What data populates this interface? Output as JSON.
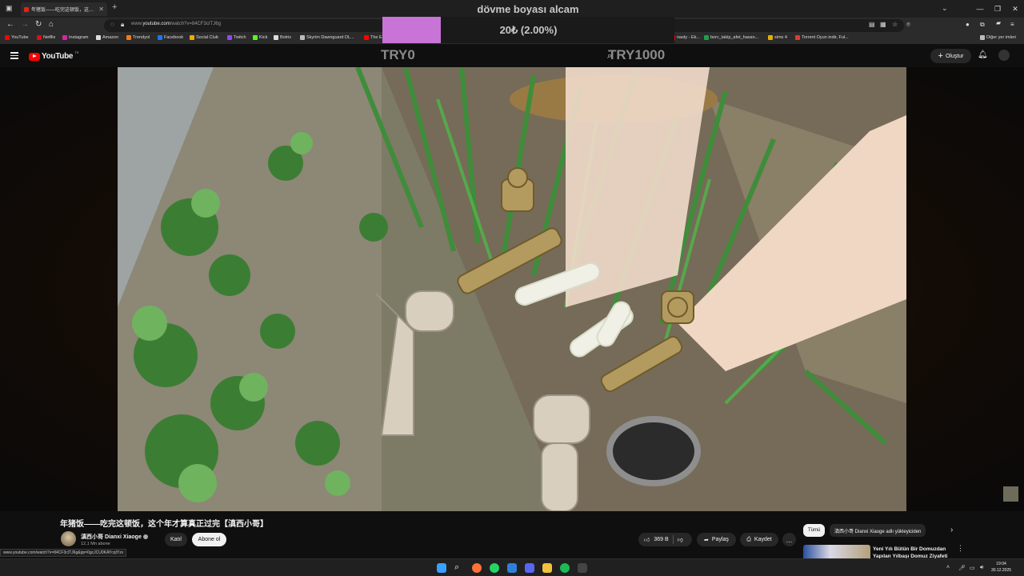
{
  "browser": {
    "tab_title": "年猪饭——吃完这顿饭，这个年",
    "url_prefix": "www.",
    "url_domain": "youtube.com",
    "url_path": "/watch?v=84CF3cITJ6g",
    "bookmarks": [
      {
        "label": "YouTube",
        "color": "#ff0000"
      },
      {
        "label": "Netflix",
        "color": "#e50914"
      },
      {
        "label": "Instagram",
        "color": "#d6249f"
      },
      {
        "label": "Amazon",
        "color": "#dddddd"
      },
      {
        "label": "Trendyol",
        "color": "#f27a1a"
      },
      {
        "label": "Facebook",
        "color": "#1877f2"
      },
      {
        "label": "Social Club",
        "color": "#f2a900"
      },
      {
        "label": "Twitch",
        "color": "#9146ff"
      },
      {
        "label": "Kick",
        "color": "#53fc18"
      },
      {
        "label": "Botrix",
        "color": "#dddddd"
      },
      {
        "label": "Skyrim Dawnguard DL...",
        "color": "#bbbbbb"
      },
      {
        "label": "The E",
        "color": "#ff0000"
      }
    ],
    "bookmarks_right": [
      {
        "label": "nasty - Ek...",
        "color": "#ff0000"
      },
      {
        "label": "borc_takip_afet_hasan...",
        "color": "#1e9e4a"
      },
      {
        "label": "sims 4",
        "color": "#e0b000"
      },
      {
        "label": "Torrent Oyun indir, Ful...",
        "color": "#e03a2f"
      }
    ],
    "other_bookmarks": "Diğer yer imleri",
    "status_url": "www.youtube.com/watch?v=84CF3cITJ6g&pp=0gcJCU0KAYcqIYzv"
  },
  "donation_overlay": {
    "goal_title": "dövme boyası alcam",
    "amount_text": "20₺ (2.00%)",
    "progress_fraction": 0.02,
    "min_label": "TRY0",
    "max_label": "TRY1000",
    "bar_color": "#c774d6"
  },
  "youtube": {
    "logo_text": "YouTube",
    "country_code": "TR",
    "create_label": "Oluştur",
    "brand_color": "#ff0000"
  },
  "video": {
    "title": "年猪饭——吃完这顿饭，这个年才算真正过完【滇西小哥】",
    "channel_name": "滇西小哥 Dianxi Xiaoge",
    "subscribers": "12,1 Mn abone",
    "join_label": "Katıl",
    "subscribe_label": "Abone ol",
    "likes": "369 B",
    "share_label": "Paylaş",
    "save_label": "Kaydet",
    "more_label": "..."
  },
  "recommendations": {
    "chips": [
      "Tümü",
      "滇西小哥 Dianxi Xiaoge adlı yükleyiciden"
    ],
    "first_title": "Yeni Yılı Bütün Bir Domuzdan Yapılan Yılbaşı Domuz Ziyafeti ile"
  },
  "taskbar": {
    "time": "19:04",
    "date": "30.12.2025"
  }
}
